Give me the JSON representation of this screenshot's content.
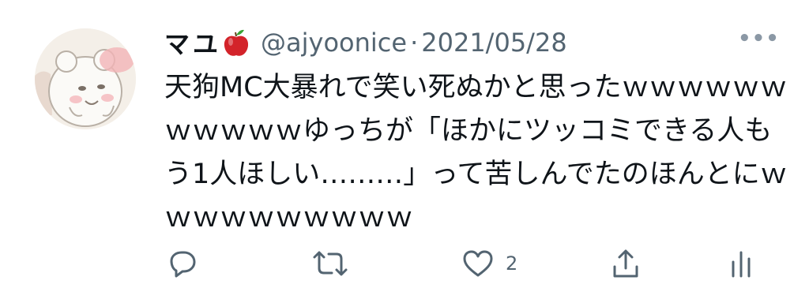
{
  "tweet": {
    "display_name": "マユ",
    "handle": "@ajyoonice",
    "separator": "·",
    "date": "2021/05/28",
    "more_label": "•••",
    "text": "天狗MC大暴れで笑い死ぬかと思ったｗｗｗｗｗｗｗｗｗｗｗゆっちが「ほかにツッコミできる人もう1人ほしい………」って苦しんでたのほんとにｗｗｗｗｗｗｗｗｗｗ"
  },
  "actions": {
    "reply_icon": "reply-icon",
    "retweet_icon": "retweet-icon",
    "like_icon": "heart-icon",
    "like_count": "2",
    "share_icon": "share-icon",
    "analytics_icon": "analytics-icon"
  },
  "colors": {
    "text_primary": "#0f1419",
    "text_secondary": "#536471",
    "apple_red": "#d3232a"
  }
}
